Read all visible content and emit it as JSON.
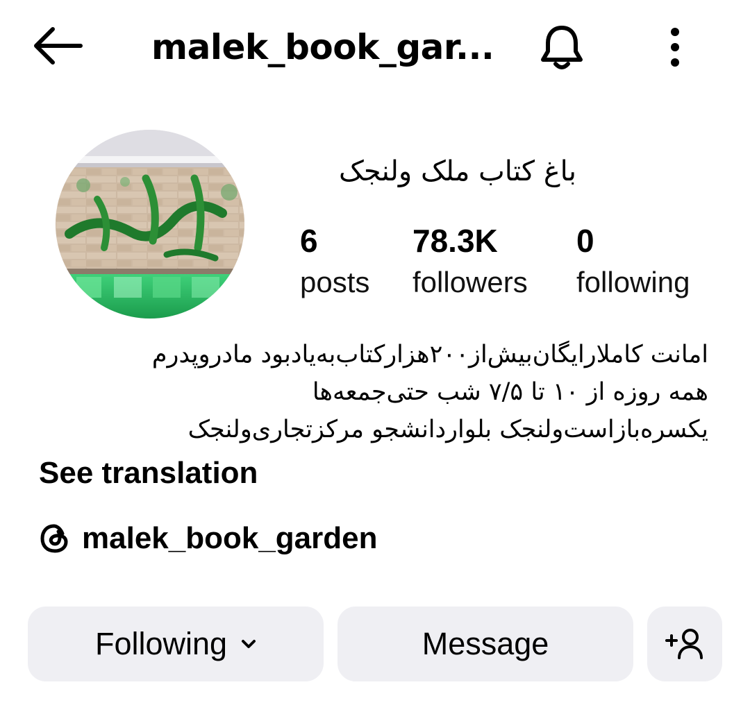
{
  "header": {
    "username": "malek_book_gar...",
    "back_icon": "arrow-left-icon",
    "notification_icon": "bell-icon",
    "more_icon": "more-vertical-icon"
  },
  "profile": {
    "display_name": "باغ کتاب ملک ولنجک",
    "stats": [
      {
        "value": "6",
        "label": "posts"
      },
      {
        "value": "78.3K",
        "label": "followers"
      },
      {
        "value": "0",
        "label": "following"
      }
    ],
    "bio_lines": [
      "امانت کاملارایگان‌بیش‌از۲۰۰هزارکتاب‌به‌یادبود مادروپدرم",
      "همه روزه از ۱۰ تا ۷/۵ شب حتی‌جمعه‌ها",
      "یکسره‌بازاست‌ولنجک بلواردانشجو مرکزتجاری‌ولنجک"
    ],
    "see_translation": "See translation",
    "threads_handle": "malek_book_garden",
    "threads_icon": "threads-icon"
  },
  "actions": {
    "following_label": "Following",
    "message_label": "Message",
    "add_person_icon": "add-person-icon"
  },
  "colors": {
    "button_bg": "#efeff3",
    "text": "#000000"
  }
}
